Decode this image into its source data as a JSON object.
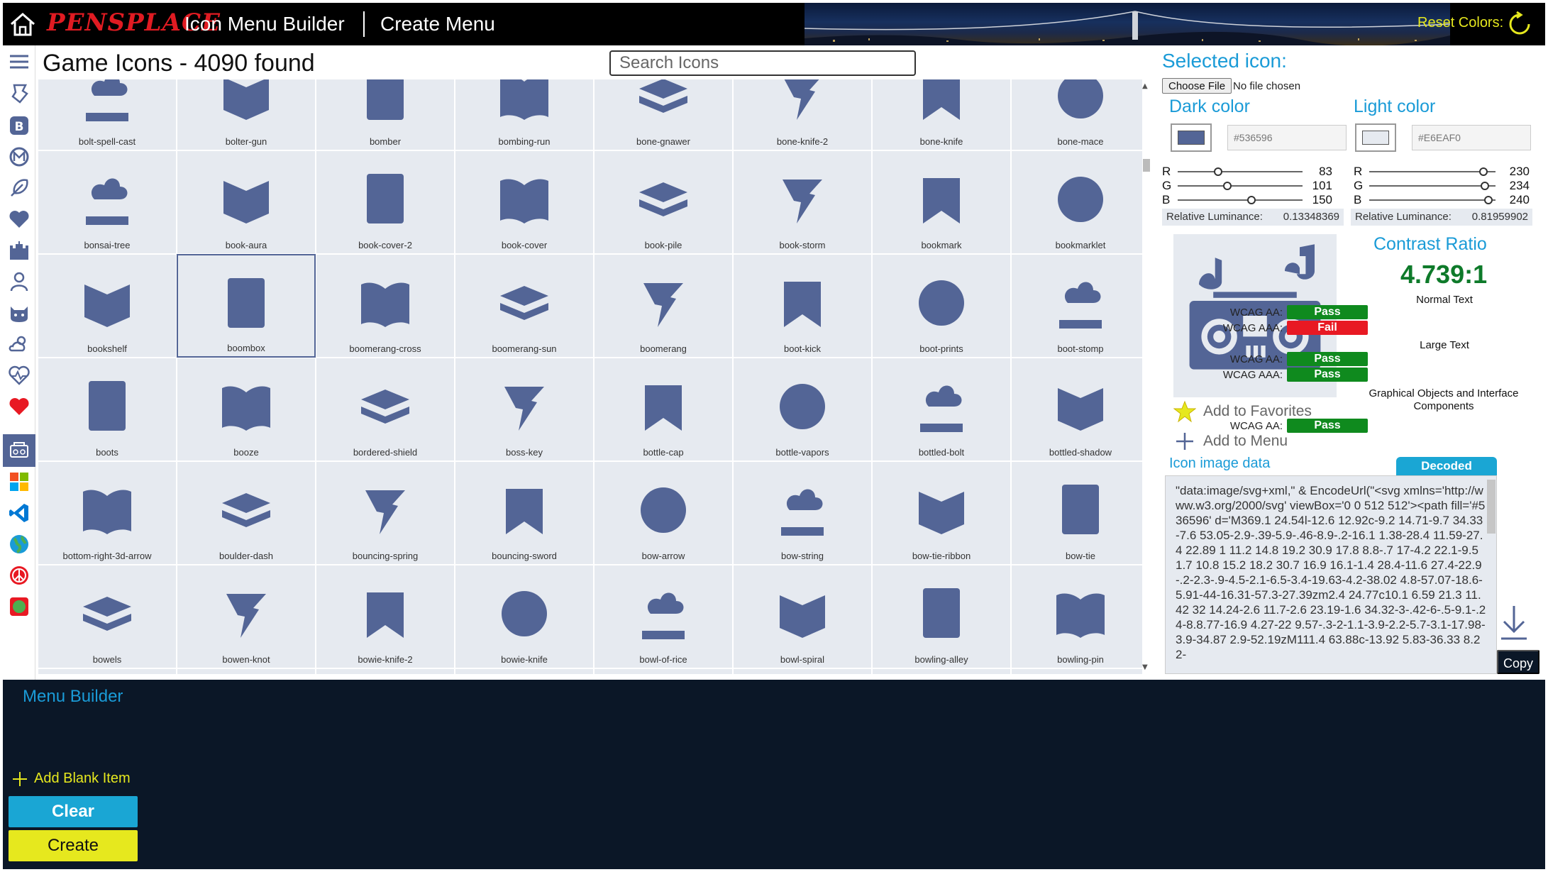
{
  "header": {
    "logo_text": "PENSPLACE",
    "app_title": "Icon Menu Builder",
    "page_title": "Create Menu",
    "reset_label": "Reset Colors:"
  },
  "grid": {
    "heading": "Game Icons - 4090 found",
    "search_placeholder": "Search Icons",
    "partial_top": [
      "bolt-spell-cast",
      "bolter-gun",
      "bomber",
      "bombing-run",
      "bone-gnawer",
      "bone-knife-2",
      "bone-knife",
      "bone-mace"
    ],
    "rows": [
      [
        "bonsai-tree",
        "book-aura",
        "book-cover-2",
        "book-cover",
        "book-pile",
        "book-storm",
        "bookmark",
        "bookmarklet"
      ],
      [
        "bookshelf",
        "boombox",
        "boomerang-cross",
        "boomerang-sun",
        "boomerang",
        "boot-kick",
        "boot-prints",
        "boot-stomp"
      ],
      [
        "boots",
        "booze",
        "bordered-shield",
        "boss-key",
        "bottle-cap",
        "bottle-vapors",
        "bottled-bolt",
        "bottled-shadow"
      ],
      [
        "bottom-right-3d-arrow",
        "boulder-dash",
        "bouncing-spring",
        "bouncing-sword",
        "bow-arrow",
        "bow-string",
        "bow-tie-ribbon",
        "bow-tie"
      ],
      [
        "bowels",
        "bowen-knot",
        "bowie-knife-2",
        "bowie-knife",
        "bowl-of-rice",
        "bowl-spiral",
        "bowling-alley",
        "bowling-pin"
      ]
    ],
    "selected": "boombox"
  },
  "panel": {
    "title": "Selected icon:",
    "choose_file": "Choose File",
    "no_file": "No file chosen",
    "dark": {
      "title": "Dark color",
      "hex": "#536596",
      "swatch": "#536596",
      "r_label": "R",
      "g_label": "G",
      "b_label": "B",
      "r": "83",
      "g": "101",
      "b": "150",
      "lum_label": "Relative Luminance:",
      "lum": "0.13348369"
    },
    "light": {
      "title": "Light color",
      "hex": "#E6EAF0",
      "swatch": "#e6eaf0",
      "r_label": "R",
      "g_label": "G",
      "b_label": "B",
      "r": "230",
      "g": "234",
      "b": "240",
      "lum_label": "Relative Luminance:",
      "lum": "0.81959902"
    },
    "contrast": {
      "title": "Contrast Ratio",
      "value": "4.739:1",
      "normal_text": "Normal Text",
      "large_text": "Large Text",
      "graphical": "Graphical Objects and Interface Components",
      "wcag_aa": "WCAG AA:",
      "wcag_aaa": "WCAG AAA:",
      "normal_aa": "Pass",
      "normal_aaa": "Fail",
      "large_aa": "Pass",
      "large_aaa": "Pass",
      "graphical_aa": "Pass"
    },
    "add_favorites": "Add to Favorites",
    "add_menu": "Add to Menu",
    "image_data_title": "Icon image data",
    "decoded_tab": "Decoded",
    "image_data": "\"data:image/svg+xml,\" & EncodeUrl(\"<svg xmlns='http://www.w3.org/2000/svg' viewBox='0 0 512 512'><path fill='#536596' d='M369.1 24.54l-12.6 12.92c-9.2 14.71-9.7 34.33-7.6 53.05-2.9-.39-5.9-.46-8.9-.2-16.1 1.38-28.4 11.59-27.4 22.89 1 11.2 14.8 19.2 30.9 17.8 8.8-.7 17-4.2 22.1-9.5 1.7 10.8 15.2 18.2 30.7 16.9 16.1-1.4 28.4-11.6 27.4-22.9-.2-2.3-.9-4.5-2.1-6.5-3.4-19.63-4.2-38.02 4.8-57.07-18.6-5.91-44-16.31-57.3-27.39zm2.4 24.77c10.1 6.59 21.3 11.42 32 14.24-2.6 11.7-2.6 23.19-1.6 34.32-3-.42-6-.5-9.1-.24-8.8.77-16.9 4.27-22 9.57-.3-2-1.1-3.9-2.2-5.7-3.1-17.98-3.9-34.87 2.9-52.19zM111.4 63.88c-13.92 5.83-36.33 8.22-",
    "copy_label": "Copy"
  },
  "menu_builder": {
    "title": "Menu Builder",
    "add_blank": "Add Blank Item",
    "clear": "Clear",
    "create": "Create"
  },
  "colors": {
    "icon": "#536596",
    "cell_bg": "#e6eaf0",
    "accent": "#1a9bd7",
    "pass": "#0f8a1e",
    "fail": "#e81923",
    "reset": "#e6e81e",
    "menu_bg": "#0b1727"
  }
}
